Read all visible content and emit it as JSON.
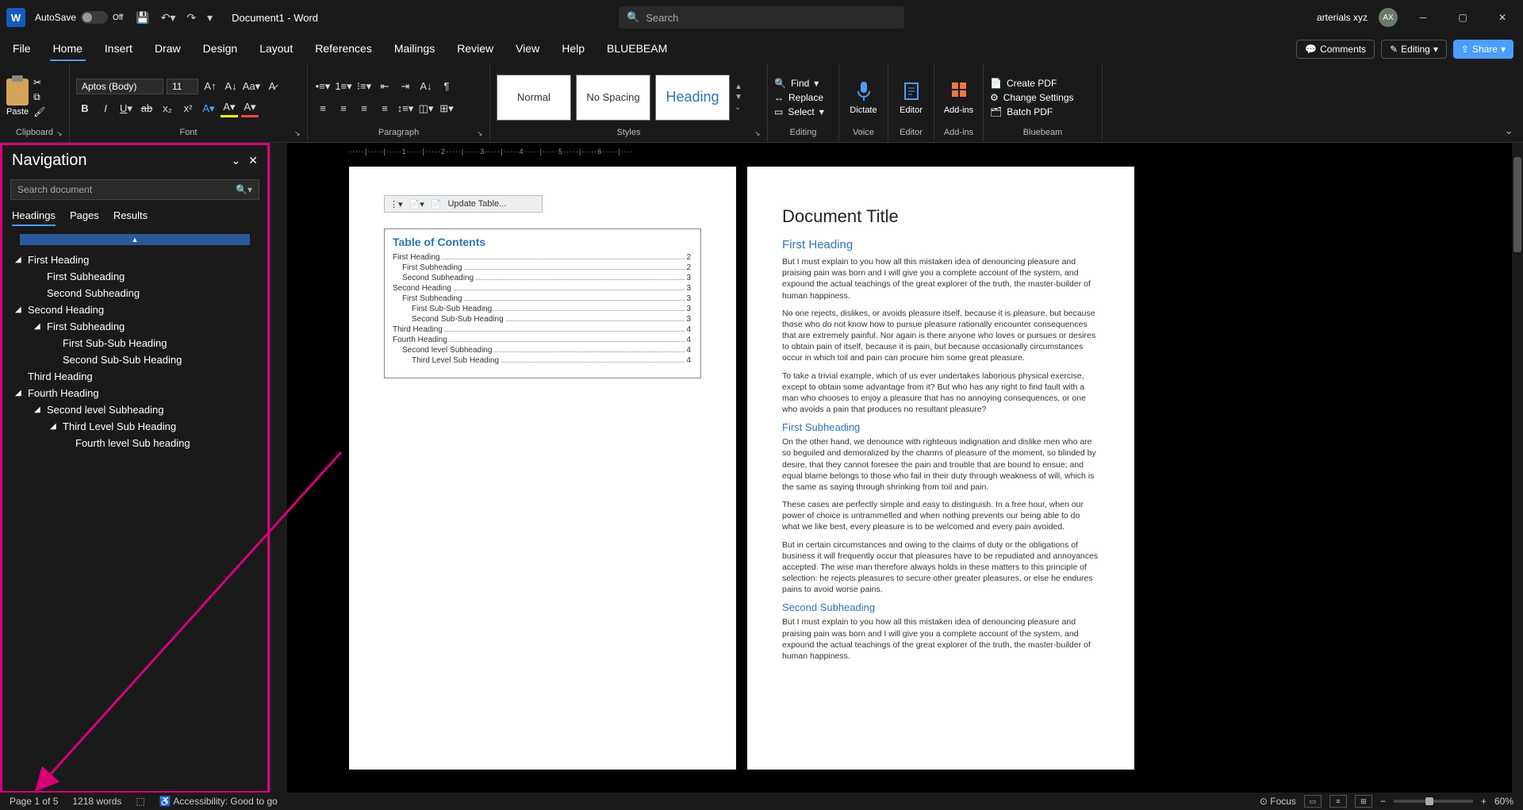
{
  "titlebar": {
    "autosave": "AutoSave",
    "autosave_state": "Off",
    "doc_title": "Document1 - Word",
    "search_placeholder": "Search",
    "user_name": "arterials xyz",
    "user_initials": "AX"
  },
  "ribbon_tabs": [
    "File",
    "Home",
    "Insert",
    "Draw",
    "Design",
    "Layout",
    "References",
    "Mailings",
    "Review",
    "View",
    "Help",
    "BLUEBEAM"
  ],
  "ribbon_active_tab": "Home",
  "ribbon_right": {
    "comments": "Comments",
    "editing": "Editing",
    "share": "Share"
  },
  "ribbon": {
    "clipboard": {
      "paste": "Paste",
      "label": "Clipboard"
    },
    "font": {
      "name": "Aptos (Body)",
      "size": "11",
      "label": "Font"
    },
    "paragraph": {
      "label": "Paragraph"
    },
    "styles": {
      "label": "Styles",
      "items": [
        "Normal",
        "No Spacing",
        "Heading"
      ]
    },
    "editing": {
      "label": "Editing",
      "find": "Find",
      "replace": "Replace",
      "select": "Select"
    },
    "voice": {
      "label": "Voice",
      "dictate": "Dictate"
    },
    "editor": {
      "label": "Editor",
      "btn": "Editor"
    },
    "addins": {
      "label": "Add-ins",
      "btn": "Add-ins"
    },
    "bluebeam": {
      "label": "Bluebeam",
      "create": "Create PDF",
      "change": "Change Settings",
      "batch": "Batch PDF"
    }
  },
  "navigation": {
    "title": "Navigation",
    "search_placeholder": "Search document",
    "tabs": [
      "Headings",
      "Pages",
      "Results"
    ],
    "tree": [
      {
        "level": 0,
        "label": "First Heading",
        "caret": true
      },
      {
        "level": 1,
        "label": "First Subheading",
        "caret": false
      },
      {
        "level": 1,
        "label": "Second Subheading",
        "caret": false
      },
      {
        "level": 0,
        "label": "Second Heading",
        "caret": true
      },
      {
        "level": 1,
        "label": "First Subheading",
        "caret": true
      },
      {
        "level": 2,
        "label": "First Sub-Sub Heading",
        "caret": false
      },
      {
        "level": 2,
        "label": "Second Sub-Sub Heading",
        "caret": false
      },
      {
        "level": 0,
        "label": "Third Heading",
        "caret": false
      },
      {
        "level": 0,
        "label": "Fourth Heading",
        "caret": true
      },
      {
        "level": 1,
        "label": "Second level Subheading",
        "caret": true
      },
      {
        "level": 2,
        "label": "Third Level Sub Heading",
        "caret": true
      },
      {
        "level": 3,
        "label": "Fourth level Sub heading",
        "caret": false
      }
    ]
  },
  "toc": {
    "update_label": "Update Table...",
    "title": "Table of Contents",
    "entries": [
      {
        "level": 1,
        "text": "First Heading",
        "page": "2"
      },
      {
        "level": 2,
        "text": "First Subheading",
        "page": "2"
      },
      {
        "level": 2,
        "text": "Second Subheading",
        "page": "3"
      },
      {
        "level": 1,
        "text": "Second Heading",
        "page": "3"
      },
      {
        "level": 2,
        "text": "First Subheading",
        "page": "3"
      },
      {
        "level": 3,
        "text": "First Sub-Sub Heading",
        "page": "3"
      },
      {
        "level": 3,
        "text": "Second Sub-Sub Heading",
        "page": "3"
      },
      {
        "level": 1,
        "text": "Third Heading",
        "page": "4"
      },
      {
        "level": 1,
        "text": "Fourth Heading",
        "page": "4"
      },
      {
        "level": 2,
        "text": "Second level Subheading",
        "page": "4"
      },
      {
        "level": 3,
        "text": "Third Level Sub Heading",
        "page": "4"
      }
    ]
  },
  "doc": {
    "title": "Document Title",
    "h1a": "First Heading",
    "p1": "But I must explain to you how all this mistaken idea of denouncing pleasure and praising pain was born and I will give you a complete account of the system, and expound the actual teachings of the great explorer of the truth, the master-builder of human happiness.",
    "p2": "No one rejects, dislikes, or avoids pleasure itself, because it is pleasure, but because those who do not know how to pursue pleasure rationally encounter consequences that are extremely painful. Nor again is there anyone who loves or pursues or desires to obtain pain of itself, because it is pain, but because occasionally circumstances occur in which toil and pain can procure him some great pleasure.",
    "p3": "To take a trivial example, which of us ever undertakes laborious physical exercise, except to obtain some advantage from it? But who has any right to find fault with a man who chooses to enjoy a pleasure that has no annoying consequences, or one who avoids a pain that produces no resultant pleasure?",
    "h2a": "First Subheading",
    "p4": "On the other hand, we denounce with righteous indignation and dislike men who are so beguiled and demoralized by the charms of pleasure of the moment, so blinded by desire, that they cannot foresee the pain and trouble that are bound to ensue; and equal blame belongs to those who fail in their duty through weakness of will, which is the same as saying through shrinking from toil and pain.",
    "p5": "These cases are perfectly simple and easy to distinguish. In a free hour, when our power of choice is untrammelled and when nothing prevents our being able to do what we like best, every pleasure is to be welcomed and every pain avoided.",
    "p6": "But in certain circumstances and owing to the claims of duty or the obligations of business it will frequently occur that pleasures have to be repudiated and annoyances accepted. The wise man therefore always holds in these matters to this principle of selection: he rejects pleasures to secure other greater pleasures, or else he endures pains to avoid worse pains.",
    "h2b": "Second Subheading",
    "p7": "But I must explain to you how all this mistaken idea of denouncing pleasure and praising pain was born and I will give you a complete account of the system, and expound the actual teachings of the great explorer of the truth, the master-builder of human happiness."
  },
  "status": {
    "page": "Page 1 of 5",
    "words": "1218 words",
    "accessibility": "Accessibility: Good to go",
    "focus": "Focus",
    "zoom": "60%"
  },
  "ruler_marks": "·····|·····|·····1·····|·····2·····|·····3·····|·····4·····|·····5·····|·····6·····|····"
}
